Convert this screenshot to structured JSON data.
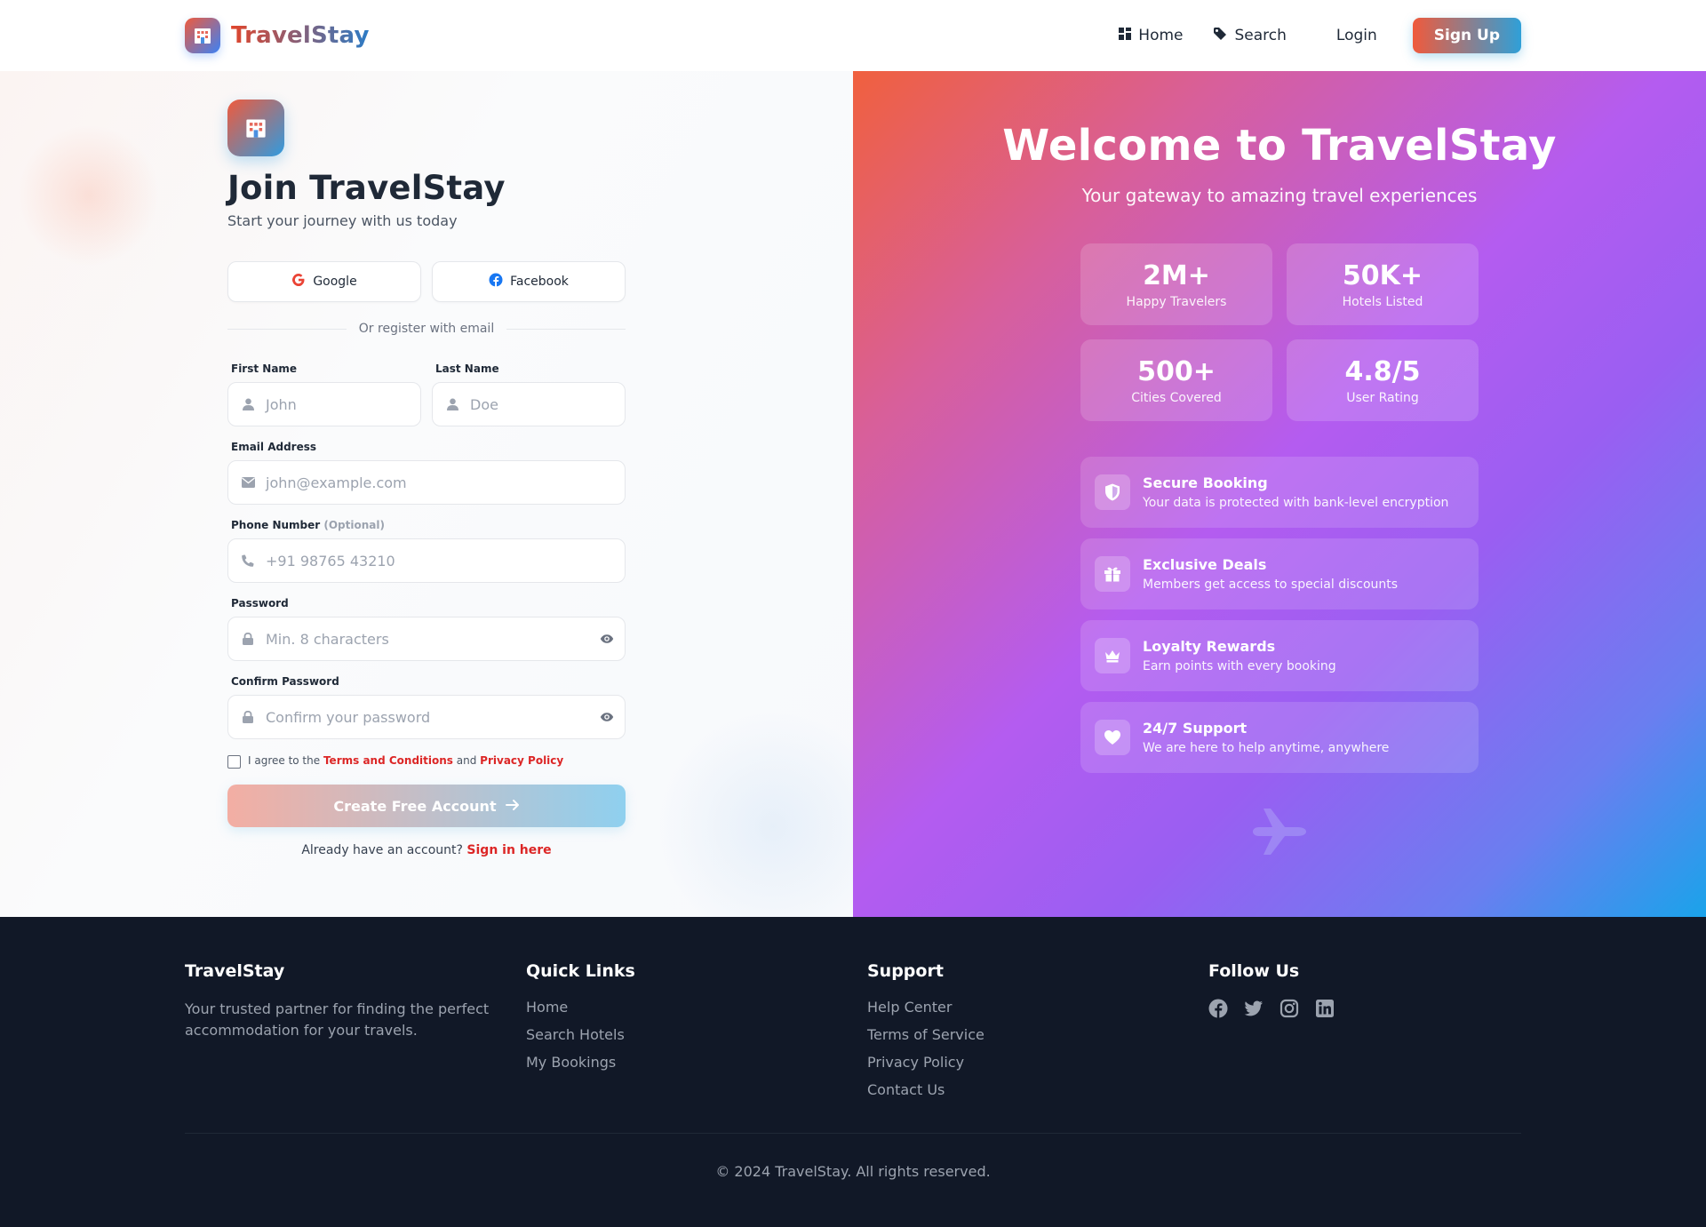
{
  "header": {
    "brand": "TravelStay",
    "nav": [
      {
        "label": "Home",
        "icon": "grid-icon"
      },
      {
        "label": "Search",
        "icon": "tag-icon"
      }
    ],
    "login": "Login",
    "signup": "Sign Up"
  },
  "form": {
    "title": "Join TravelStay",
    "subtitle": "Start your journey with us today",
    "google": "Google",
    "facebook": "Facebook",
    "divider": "Or register with email",
    "first_name": {
      "label": "First Name",
      "placeholder": "John"
    },
    "last_name": {
      "label": "Last Name",
      "placeholder": "Doe"
    },
    "email": {
      "label": "Email Address",
      "placeholder": "john@example.com"
    },
    "phone": {
      "label": "Phone Number",
      "optional": "(Optional)",
      "placeholder": "+91 98765 43210"
    },
    "password": {
      "label": "Password",
      "placeholder": "Min. 8 characters"
    },
    "confirm": {
      "label": "Confirm Password",
      "placeholder": "Confirm your password"
    },
    "agree_prefix": "I agree to the",
    "terms": "Terms and Conditions",
    "and": "and",
    "privacy": "Privacy Policy",
    "submit": "Create Free Account",
    "have_account": "Already have an account?",
    "signin": "Sign in here"
  },
  "hero": {
    "title": "Welcome to TravelStay",
    "subtitle": "Your gateway to amazing travel experiences",
    "stats": [
      {
        "value": "2M+",
        "label": "Happy Travelers"
      },
      {
        "value": "50K+",
        "label": "Hotels Listed"
      },
      {
        "value": "500+",
        "label": "Cities Covered"
      },
      {
        "value": "4.8/5",
        "label": "User Rating"
      }
    ],
    "features": [
      {
        "title": "Secure Booking",
        "desc": "Your data is protected with bank-level encryption",
        "icon": "shield-icon"
      },
      {
        "title": "Exclusive Deals",
        "desc": "Members get access to special discounts",
        "icon": "gift-icon"
      },
      {
        "title": "Loyalty Rewards",
        "desc": "Earn points with every booking",
        "icon": "crown-icon"
      },
      {
        "title": "24/7 Support",
        "desc": "We are here to help anytime, anywhere",
        "icon": "heart-icon"
      }
    ]
  },
  "footer": {
    "brand": "TravelStay",
    "about": "Your trusted partner for finding the perfect accommodation for your travels.",
    "quick_links": {
      "title": "Quick Links",
      "items": [
        "Home",
        "Search Hotels",
        "My Bookings"
      ]
    },
    "support": {
      "title": "Support",
      "items": [
        "Help Center",
        "Terms of Service",
        "Privacy Policy",
        "Contact Us"
      ]
    },
    "follow": {
      "title": "Follow Us",
      "icons": [
        "facebook-icon",
        "twitter-icon",
        "instagram-icon",
        "linkedin-icon"
      ]
    },
    "copyright": "© 2024 TravelStay. All rights reserved."
  },
  "colors": {
    "brand_orange": "#f05a3c",
    "brand_blue": "#2fa0d8",
    "link_red": "#dc2626",
    "footer_bg": "#111827"
  }
}
